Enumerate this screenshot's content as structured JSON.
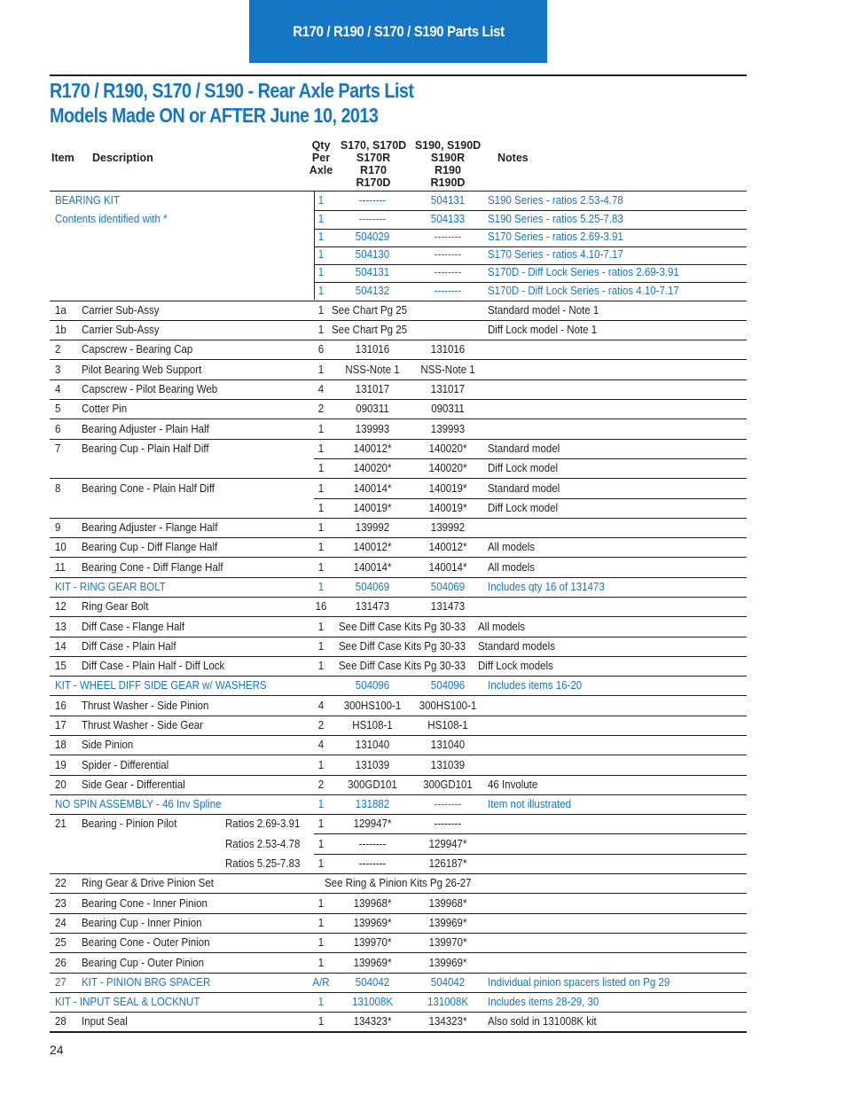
{
  "banner": {
    "title": "R170 / R190 / S170 / S190 Parts List"
  },
  "heading": {
    "line1": "R170 / R190, S170 / S190 - Rear Axle Parts List",
    "line2": "Models Made ON or AFTER June 10, 2013"
  },
  "columns": {
    "item": "Item",
    "description": "Description",
    "qty": [
      "Qty",
      "Per",
      "Axle"
    ],
    "s170": [
      "S170, S170D",
      "S170R",
      "R170",
      "R170D"
    ],
    "s190": [
      "S190, S190D",
      "S190R",
      "R190",
      "R190D"
    ],
    "notes": "Notes"
  },
  "colors": {
    "accent": "#1576c5",
    "text": "#231f20"
  },
  "rows": [
    {
      "item": "",
      "desc": "BEARING KIT",
      "sub": "",
      "qty": "1",
      "s170": "--------",
      "s190": "504131",
      "notes": "S190 Series - ratios  2.53-4.78",
      "kit": true
    },
    {
      "item": "",
      "desc": "Contents identified with *",
      "sub": "",
      "qty": "1",
      "s170": "--------",
      "s190": "504133",
      "notes": "S190 Series - ratios  5.25-7.83",
      "kit": true
    },
    {
      "item": "",
      "desc": "",
      "sub": "",
      "qty": "1",
      "s170": "504029",
      "s190": "--------",
      "notes": "S170 Series - ratios  2.69-3.91",
      "kit": true
    },
    {
      "item": "",
      "desc": "",
      "sub": "",
      "qty": "1",
      "s170": "504130",
      "s190": "--------",
      "notes": "S170 Series - ratios  4.10-7.17",
      "kit": true
    },
    {
      "item": "",
      "desc": "",
      "sub": "",
      "qty": "1",
      "s170": "504131",
      "s190": "--------",
      "notes": "S170D - Diff Lock Series - ratios  2.69-3.91",
      "kit": true
    },
    {
      "item": "",
      "desc": "",
      "sub": "",
      "qty": "1",
      "s170": "504132",
      "s190": "--------",
      "notes": "S170D - Diff Lock Series - ratios  4.10-7.17",
      "kit": true
    },
    {
      "item": "1a",
      "desc": "Carrier Sub-Assy",
      "sub": "",
      "qty": "1",
      "s170": "See Chart Pg 25",
      "s190": "",
      "notes": "Standard model - Note 1",
      "kit": false
    },
    {
      "item": "1b",
      "desc": "Carrier Sub-Assy",
      "sub": "",
      "qty": "1",
      "s170": "See Chart Pg 25",
      "s190": "",
      "notes": "Diff Lock model - Note 1",
      "kit": false
    },
    {
      "item": "2",
      "desc": "Capscrew - Bearing Cap",
      "sub": "",
      "qty": "6",
      "s170": "131016",
      "s190": "131016",
      "notes": "",
      "kit": false
    },
    {
      "item": "3",
      "desc": "Pilot Bearing Web Support",
      "sub": "",
      "qty": "1",
      "s170": "NSS-Note 1",
      "s190": "NSS-Note 1",
      "notes": "",
      "kit": false
    },
    {
      "item": "4",
      "desc": "Capscrew - Pilot Bearing Web",
      "sub": "",
      "qty": "4",
      "s170": "131017",
      "s190": "131017",
      "notes": "",
      "kit": false
    },
    {
      "item": "5",
      "desc": "Cotter Pin",
      "sub": "",
      "qty": "2",
      "s170": "090311",
      "s190": "090311",
      "notes": "",
      "kit": false
    },
    {
      "item": "6",
      "desc": "Bearing Adjuster - Plain Half",
      "sub": "",
      "qty": "1",
      "s170": "139993",
      "s190": "139993",
      "notes": "",
      "kit": false
    },
    {
      "item": "7",
      "desc": "Bearing Cup - Plain Half Diff",
      "sub": "",
      "qty": "1",
      "s170": "140012*",
      "s190": "140020*",
      "notes": "Standard model",
      "kit": false
    },
    {
      "item": "",
      "desc": "",
      "sub": "",
      "qty": "1",
      "s170": "140020*",
      "s190": "140020*",
      "notes": "Diff Lock model",
      "kit": false
    },
    {
      "item": "8",
      "desc": "Bearing Cone - Plain Half Diff",
      "sub": "",
      "qty": "1",
      "s170": "140014*",
      "s190": "140019*",
      "notes": "Standard model",
      "kit": false
    },
    {
      "item": "",
      "desc": "",
      "sub": "",
      "qty": "1",
      "s170": "140019*",
      "s190": "140019*",
      "notes": "Diff Lock model",
      "kit": false
    },
    {
      "item": "9",
      "desc": "Bearing Adjuster - Flange Half",
      "sub": "",
      "qty": "1",
      "s170": "139992",
      "s190": "139992",
      "notes": "",
      "kit": false
    },
    {
      "item": "10",
      "desc": "Bearing Cup - Diff Flange Half",
      "sub": "",
      "qty": "1",
      "s170": "140012*",
      "s190": "140012*",
      "notes": "All models",
      "kit": false
    },
    {
      "item": "11",
      "desc": "Bearing Cone - Diff Flange Half",
      "sub": "",
      "qty": "1",
      "s170": "140014*",
      "s190": "140014*",
      "notes": "All models",
      "kit": false
    },
    {
      "item": "",
      "desc": "KIT - RING GEAR BOLT",
      "sub": "",
      "qty": "1",
      "s170": "504069",
      "s190": "504069",
      "notes": "Includes qty 16 of 131473",
      "kit": true
    },
    {
      "item": "12",
      "desc": "Ring Gear Bolt",
      "sub": "",
      "qty": "16",
      "s170": "131473",
      "s190": "131473",
      "notes": "",
      "kit": false
    },
    {
      "item": "13",
      "desc": "Diff Case - Flange Half",
      "sub": "",
      "qty": "1",
      "s170": "See Diff Case Kits Pg 30-33",
      "s190": "",
      "notes": "All models",
      "kit": false
    },
    {
      "item": "14",
      "desc": "Diff Case - Plain Half",
      "sub": "",
      "qty": "1",
      "s170": "See Diff Case Kits Pg 30-33",
      "s190": "",
      "notes": "Standard models",
      "kit": false
    },
    {
      "item": "15",
      "desc": "Diff Case - Plain Half - Diff Lock",
      "sub": "",
      "qty": "1",
      "s170": "See Diff Case Kits Pg 30-33",
      "s190": "",
      "notes": "Diff Lock models",
      "kit": false
    },
    {
      "item": "",
      "desc": "KIT - WHEEL DIFF SIDE GEAR w/ WASHERS",
      "sub": "",
      "qty": "",
      "s170": "504096",
      "s190": "504096",
      "notes": "Includes items 16-20",
      "kit": true
    },
    {
      "item": "16",
      "desc": "Thrust Washer - Side Pinion",
      "sub": "",
      "qty": "4",
      "s170": "300HS100-1",
      "s190": "300HS100-1",
      "notes": "",
      "kit": false
    },
    {
      "item": "17",
      "desc": "Thrust Washer - Side Gear",
      "sub": "",
      "qty": "2",
      "s170": "HS108-1",
      "s190": "HS108-1",
      "notes": "",
      "kit": false
    },
    {
      "item": "18",
      "desc": "Side Pinion",
      "sub": "",
      "qty": "4",
      "s170": "131040",
      "s190": "131040",
      "notes": "",
      "kit": false
    },
    {
      "item": "19",
      "desc": "Spider - Differential",
      "sub": "",
      "qty": "1",
      "s170": "131039",
      "s190": "131039",
      "notes": "",
      "kit": false
    },
    {
      "item": "20",
      "desc": "Side Gear - Differential",
      "sub": "",
      "qty": "2",
      "s170": "300GD101",
      "s190": "300GD101",
      "notes": "46 Involute",
      "kit": false
    },
    {
      "item": "",
      "desc": "NO SPIN ASSEMBLY - 46 Inv Spline",
      "sub": "",
      "qty": "1",
      "s170": "131882",
      "s190": "--------",
      "notes": "Item not illustrated",
      "kit": true
    },
    {
      "item": "21",
      "desc": "Bearing - Pinion Pilot",
      "sub": "Ratios 2.69-3.91",
      "qty": "1",
      "s170": "129947*",
      "s190": "--------",
      "notes": "",
      "kit": false
    },
    {
      "item": "",
      "desc": "",
      "sub": "Ratios 2.53-4.78",
      "qty": "1",
      "s170": "--------",
      "s190": "129947*",
      "notes": "",
      "kit": false
    },
    {
      "item": "",
      "desc": "",
      "sub": "Ratios 5.25-7.83",
      "qty": "1",
      "s170": "--------",
      "s190": "126187*",
      "notes": "",
      "kit": false
    },
    {
      "item": "22",
      "desc": "Ring Gear & Drive Pinion Set",
      "sub": "",
      "qty": "",
      "s170": "See Ring & Pinion Kits Pg 26-27",
      "s190": "",
      "notes": "",
      "kit": false
    },
    {
      "item": "23",
      "desc": "Bearing Cone - Inner Pinion",
      "sub": "",
      "qty": "1",
      "s170": "139968*",
      "s190": "139968*",
      "notes": "",
      "kit": false
    },
    {
      "item": "24",
      "desc": "Bearing Cup - Inner Pinion",
      "sub": "",
      "qty": "1",
      "s170": "139969*",
      "s190": "139969*",
      "notes": "",
      "kit": false
    },
    {
      "item": "25",
      "desc": "Bearing Cone - Outer Pinion",
      "sub": "",
      "qty": "1",
      "s170": "139970*",
      "s190": "139970*",
      "notes": "",
      "kit": false
    },
    {
      "item": "26",
      "desc": "Bearing Cup - Outer Pinion",
      "sub": "",
      "qty": "1",
      "s170": "139969*",
      "s190": "139969*",
      "notes": "",
      "kit": false
    },
    {
      "item": "27",
      "desc": "KIT - PINION BRG SPACER",
      "sub": "",
      "qty": "A/R",
      "s170": "504042",
      "s190": "504042",
      "notes": "Individual pinion spacers listed on Pg 29",
      "kit": true
    },
    {
      "item": "",
      "desc": "KIT - INPUT SEAL & LOCKNUT",
      "sub": "",
      "qty": "1",
      "s170": "131008K",
      "s190": "131008K",
      "notes": "Includes items 28-29, 30",
      "kit": true
    },
    {
      "item": "28",
      "desc": "Input Seal",
      "sub": "",
      "qty": "1",
      "s170": "134323*",
      "s190": "134323*",
      "notes": "Also sold in 131008K kit",
      "kit": false
    }
  ],
  "page_number": "24"
}
